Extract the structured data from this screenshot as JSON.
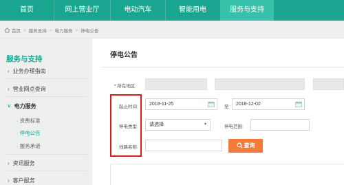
{
  "nav": {
    "items": [
      {
        "label": "首页",
        "active": false
      },
      {
        "label": "网上营业厅",
        "active": false
      },
      {
        "label": "电动汽车",
        "active": false
      },
      {
        "label": "智能用电",
        "active": false
      },
      {
        "label": "服务与支持",
        "active": true
      }
    ],
    "color": "#1aa591",
    "active_color": "#37c0aa"
  },
  "breadcrumb": {
    "icon": "home-icon",
    "items": [
      "首页",
      "服务支持",
      "电力服务",
      "停电公告"
    ]
  },
  "sidebar": {
    "title": "服务与支持",
    "items": [
      {
        "label": "业务办理指南",
        "expanded": false
      },
      {
        "label": "营业网点查询",
        "expanded": false
      },
      {
        "label": "电力服务",
        "expanded": true,
        "children": [
          "资费标准",
          "停电公告",
          "服务承诺"
        ],
        "active_child": "停电公告"
      },
      {
        "label": "资讯服务",
        "expanded": false
      },
      {
        "label": "客户服务",
        "expanded": false
      }
    ]
  },
  "main": {
    "title": "停电公告",
    "form": {
      "region_label": "* 所在地区:",
      "date_label": "起止时间:",
      "date_from": "2018-11-25",
      "date_sep": "至",
      "date_to": "2018-12-02",
      "type_label": "停电类型:",
      "type_value": "请选择",
      "range_label": "停电范围:",
      "range_value": "",
      "line_label": "线路名称:",
      "line_value": "",
      "query_label": "查询"
    },
    "accent": "#f27a3a",
    "highlight_color": "#d81d1d"
  }
}
